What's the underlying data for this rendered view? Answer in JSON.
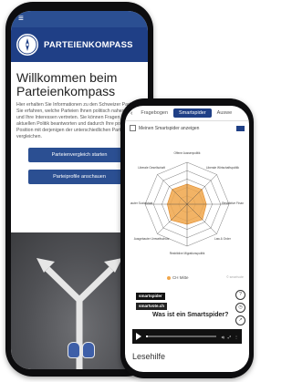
{
  "back_phone": {
    "app_title": "PARTEIENKOMPASS",
    "welcome": "Willkommen beim Parteienkompass",
    "intro": "Hier erhalten Sie Informationen zu den Schweizer Parteien. Sie erfahren, welche Parteien Ihnen politisch nahestehen und Ihre Interessen vertreten. Sie können Fragen zur aktuellen Politik beantworten und dadurch Ihre politische Position mit derjenigen der unterschiedlichen Parteien vergleichen.",
    "buttons": [
      "Parteienvergleich starten",
      "Parteiprofile anschauen"
    ]
  },
  "front_phone": {
    "tabs": [
      "Fragebogen",
      "Smartspider",
      "Auswe"
    ],
    "active_tab": 1,
    "checkbox_label": "Meinen Smartspider anzeigen",
    "radar": {
      "axes": [
        "Offene Aussenpolitik",
        "Liberale Wirtschaftspolitik",
        "Restriktive Finanzpolitik",
        "Law & Order",
        "Restriktive Migrationspolitik",
        "Ausgebauter Umweltschutz",
        "Ausgebauter Sozialstaat",
        "Liberale Gesellschaft"
      ],
      "values": [
        48,
        50,
        46,
        52,
        48,
        54,
        47,
        50
      ],
      "rings": 5
    },
    "legend_label": "CH Mitte",
    "copyright": "© smartvote",
    "logos": [
      "smartspider",
      "smartvote.ch"
    ],
    "video": {
      "title": "Was ist ein Smartspider?",
      "time": "00:00",
      "progress": 0.02
    },
    "footer": "Lesehilfe",
    "colors": {
      "accent": "#1f3f86",
      "fill": "#f0a64a"
    }
  }
}
